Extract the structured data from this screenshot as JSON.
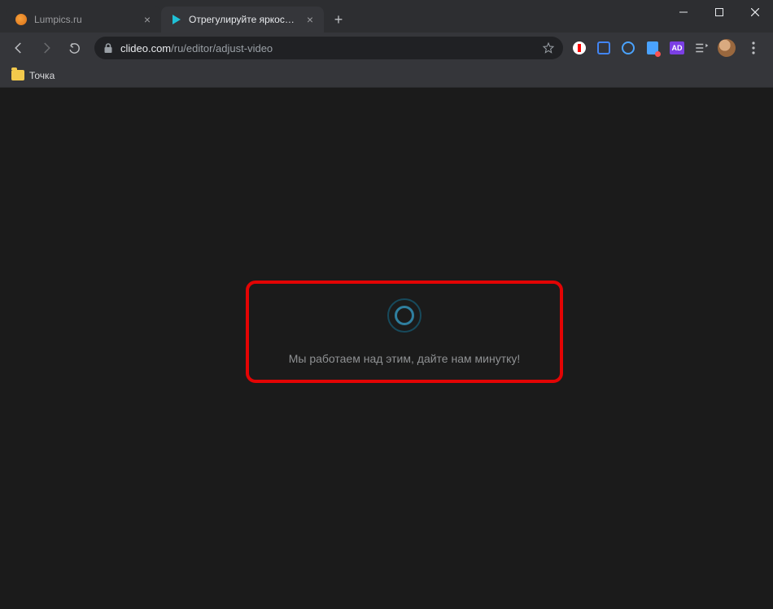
{
  "tabs": [
    {
      "title": "Lumpics.ru",
      "active": false
    },
    {
      "title": "Отрегулируйте яркость, контрас",
      "active": true
    }
  ],
  "newtab_label": "+",
  "window_controls": {
    "min": "—",
    "max": "▢",
    "close": "✕"
  },
  "nav": {
    "back": "←",
    "forward": "→",
    "reload": "⟳"
  },
  "omnibox": {
    "host": "clideo.com",
    "path": "/ru/editor/adjust-video",
    "star": "☆"
  },
  "extensions": {
    "pu_label": "AD"
  },
  "bookmarks": [
    {
      "label": "Точка"
    }
  ],
  "page": {
    "loading_message": "Мы работаем над этим, дайте нам минутку!"
  }
}
